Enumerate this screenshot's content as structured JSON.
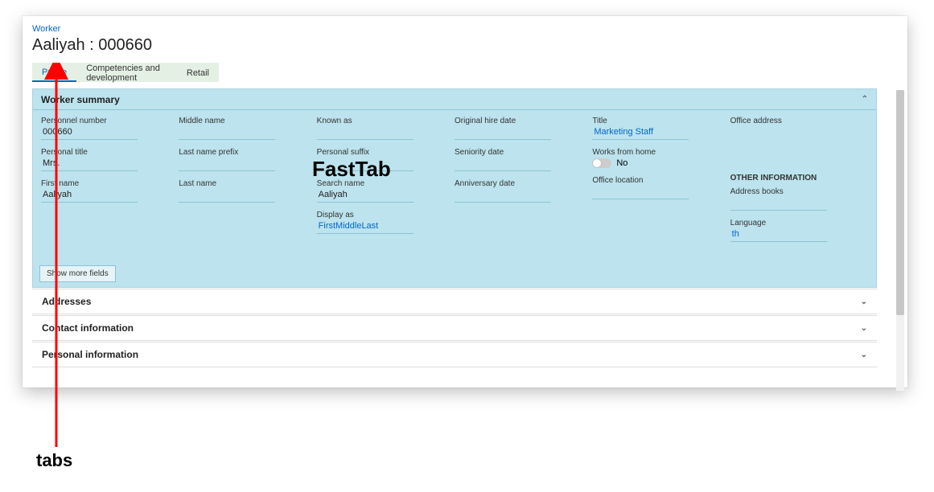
{
  "breadcrumb": "Worker",
  "title": "Aaliyah : 000660",
  "tabs": {
    "profile": "Profile",
    "comp": "Competencies and development",
    "retail": "Retail"
  },
  "worker_summary": {
    "header": "Worker summary",
    "personnel_number_lbl": "Personnel number",
    "personnel_number": "000660",
    "personal_title_lbl": "Personal title",
    "personal_title": "Mrs.",
    "first_name_lbl": "First name",
    "first_name": "Aaliyah",
    "middle_name_lbl": "Middle name",
    "last_name_prefix_lbl": "Last name prefix",
    "last_name_lbl": "Last name",
    "known_as_lbl": "Known as",
    "personal_suffix_lbl": "Personal suffix",
    "search_name_lbl": "Search name",
    "search_name": "Aaliyah",
    "display_as_lbl": "Display as",
    "display_as": "FirstMiddleLast",
    "orig_hire_lbl": "Original hire date",
    "seniority_lbl": "Seniority date",
    "anniv_lbl": "Anniversary date",
    "title_lbl": "Title",
    "title_val": "Marketing Staff",
    "wfh_lbl": "Works from home",
    "wfh_val": "No",
    "office_loc_lbl": "Office location",
    "office_addr_lbl": "Office address",
    "other_info_head": "OTHER INFORMATION",
    "addr_books_lbl": "Address books",
    "language_lbl": "Language",
    "language_val": "th",
    "show_more": "Show more fields"
  },
  "collapsed_tabs": {
    "addresses": "Addresses",
    "contact": "Contact information",
    "personal": "Personal information"
  },
  "annotations": {
    "fasttab": "FastTab",
    "tabs": "tabs"
  }
}
